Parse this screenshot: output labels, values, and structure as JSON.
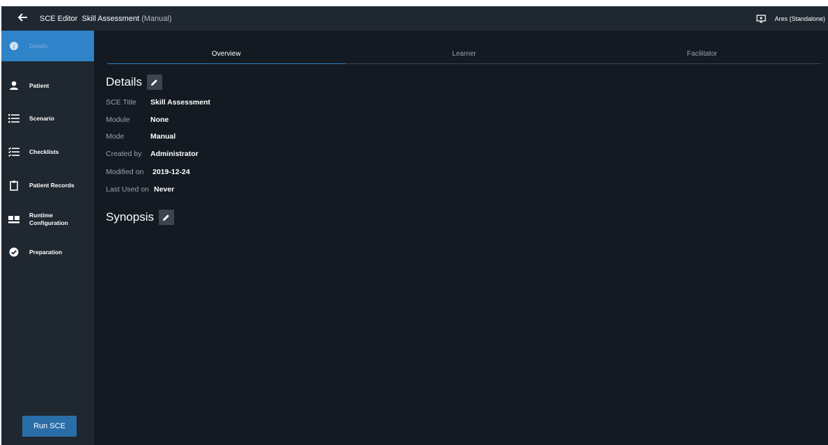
{
  "topbar": {
    "app_label": "SCE Editor",
    "sce_name": "Skill Assessment",
    "mode_label": "(Manual)",
    "station_label": "Ares (Standalone)",
    "icons": {
      "back": "arrow-left-icon",
      "monitor": "monitor-icon"
    }
  },
  "sidebar": {
    "items": [
      {
        "label": "Details",
        "icon": "info-icon",
        "active": true
      },
      {
        "label": "Patient",
        "icon": "person-icon",
        "active": false
      },
      {
        "label": "Scenario",
        "icon": "list-icon",
        "active": false
      },
      {
        "label": "Checklists",
        "icon": "checklist-icon",
        "active": false
      },
      {
        "label": "Patient Records",
        "icon": "clipboard-icon",
        "active": false
      },
      {
        "label_line1": "Runtime",
        "label_line2": "Configuration",
        "icon": "dashboard-icon",
        "active": false
      },
      {
        "label": "Preparation",
        "icon": "check-circle-icon",
        "active": false
      }
    ],
    "run_button": "Run SCE"
  },
  "tabs": [
    {
      "label": "Overview",
      "active": true
    },
    {
      "label": "Learner",
      "active": false
    },
    {
      "label": "Facilitator",
      "active": false
    }
  ],
  "details": {
    "title": "Details",
    "rows": [
      {
        "key": "SCE Title",
        "value": "Skill Assessment"
      },
      {
        "key": "Module",
        "value": "None"
      },
      {
        "key": "Mode",
        "value": "Manual"
      },
      {
        "key": "Created by",
        "value": "Administrator"
      },
      {
        "key": "Modified on",
        "value": "2019-12-24"
      },
      {
        "key": "Last Used on",
        "value": "Never"
      }
    ]
  },
  "synopsis": {
    "title": "Synopsis"
  },
  "colors": {
    "accent": "#2f83c9",
    "background": "#131a22",
    "sidebar": "#1f2730",
    "button": "#2a6ea8"
  }
}
